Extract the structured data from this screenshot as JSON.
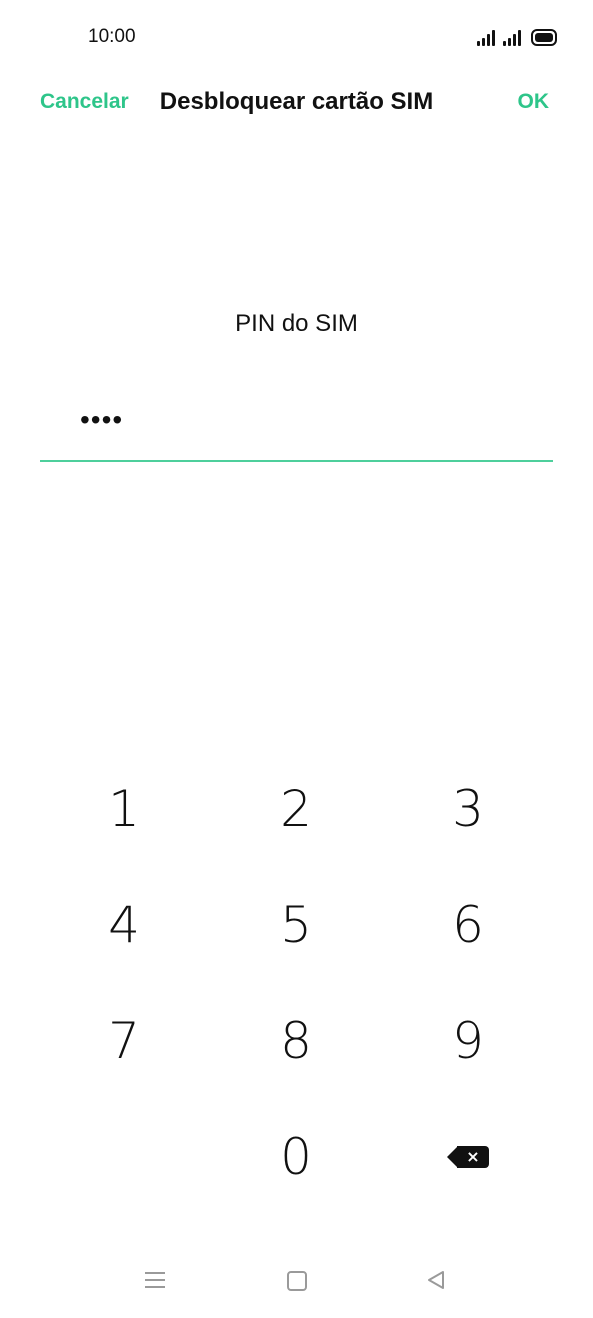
{
  "status_bar": {
    "time": "10:00"
  },
  "header": {
    "cancel_label": "Cancelar",
    "title": "Desbloquear cartão SIM",
    "ok_label": "OK"
  },
  "pin": {
    "label": "PIN do SIM",
    "value": "••••"
  },
  "keypad": {
    "keys": [
      "1",
      "2",
      "3",
      "4",
      "5",
      "6",
      "7",
      "8",
      "9",
      "0"
    ],
    "backspace_symbol": "×"
  },
  "colors": {
    "accent": "#2ec58a",
    "underline": "#4ecf9c",
    "nav_icons": "#9a9a9a"
  },
  "icons": {
    "signal_1": "signal-icon",
    "signal_2": "signal-icon",
    "battery": "battery-icon",
    "backspace": "backspace-icon",
    "nav_menu": "menu-icon",
    "nav_home": "home-icon",
    "nav_back": "back-icon"
  }
}
